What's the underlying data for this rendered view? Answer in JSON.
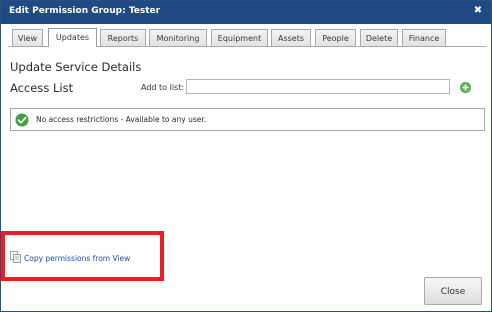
{
  "dialog": {
    "title": "Edit Permission Group: Tester",
    "close_glyph": "✖"
  },
  "tabs": [
    {
      "label": "View"
    },
    {
      "label": "Updates",
      "active": true
    },
    {
      "label": "Reports"
    },
    {
      "label": "Monitoring"
    },
    {
      "label": "Equipment"
    },
    {
      "label": "Assets"
    },
    {
      "label": "People"
    },
    {
      "label": "Delete"
    },
    {
      "label": "Finance"
    }
  ],
  "content": {
    "heading": "Update Service Details",
    "access_list_heading": "Access List",
    "add_to_list_label": "Add to list:",
    "add_to_list_value": "",
    "status_message": "No access restrictions - Available to any user.",
    "copy_link": "Copy permissions from View"
  },
  "footer": {
    "close_label": "Close"
  },
  "colors": {
    "titlebar": "#1e4b85",
    "link": "#1f4ea8",
    "highlight": "#ee1c25",
    "success": "#3ea33e"
  }
}
